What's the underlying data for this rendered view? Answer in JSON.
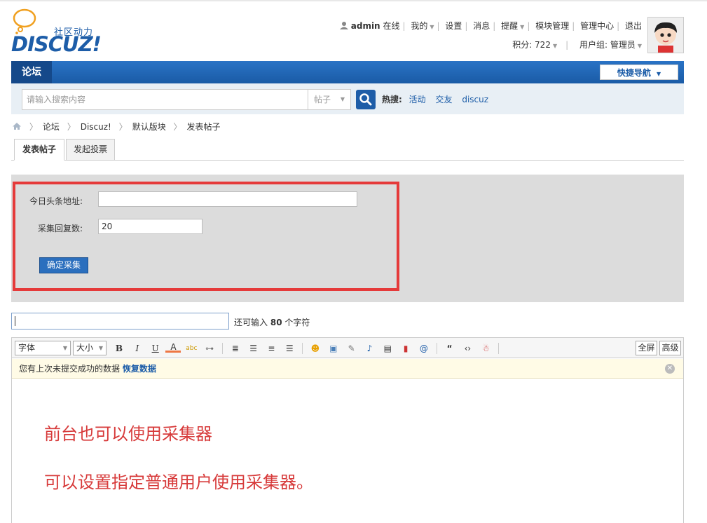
{
  "logo": {
    "tagline": "社区动力",
    "wordmark": "DISCUZ!"
  },
  "user": {
    "name": "admin",
    "status": "在线",
    "links": [
      "我的",
      "设置",
      "消息",
      "提醒",
      "模块管理",
      "管理中心",
      "退出"
    ],
    "points_label": "积分: 722",
    "group_label": "用户组: 管理员"
  },
  "nav": {
    "forum_tab": "论坛",
    "quick_nav": "快捷导航"
  },
  "search": {
    "placeholder": "请输入搜索内容",
    "type": "帖子",
    "hot_label": "热搜:",
    "hot_terms": [
      "活动",
      "交友",
      "discuz"
    ]
  },
  "breadcrumb": [
    "论坛",
    "Discuz!",
    "默认版块",
    "发表帖子"
  ],
  "tabs": [
    "发表帖子",
    "发起投票"
  ],
  "collector": {
    "url_label": "今日头条地址:",
    "url_value": "",
    "reply_label": "采集回复数:",
    "reply_value": "20",
    "confirm_label": "确定采集"
  },
  "title": {
    "remain_prefix": "还可输入",
    "remain_count": "80",
    "remain_suffix": "个字符"
  },
  "editor": {
    "font_label": "字体",
    "size_label": "大小",
    "fullscreen_label": "全屏",
    "advanced_label": "高级",
    "notice_text": "您有上次未提交成功的数据",
    "restore_label": "恢复数据",
    "content_lines": [
      "前台也可以使用采集器",
      "可以设置指定普通用户使用采集器。"
    ]
  },
  "colors": {
    "brand": "#1d5da8",
    "highlight_frame": "#e53a3a",
    "content_text": "#d73a3a"
  }
}
